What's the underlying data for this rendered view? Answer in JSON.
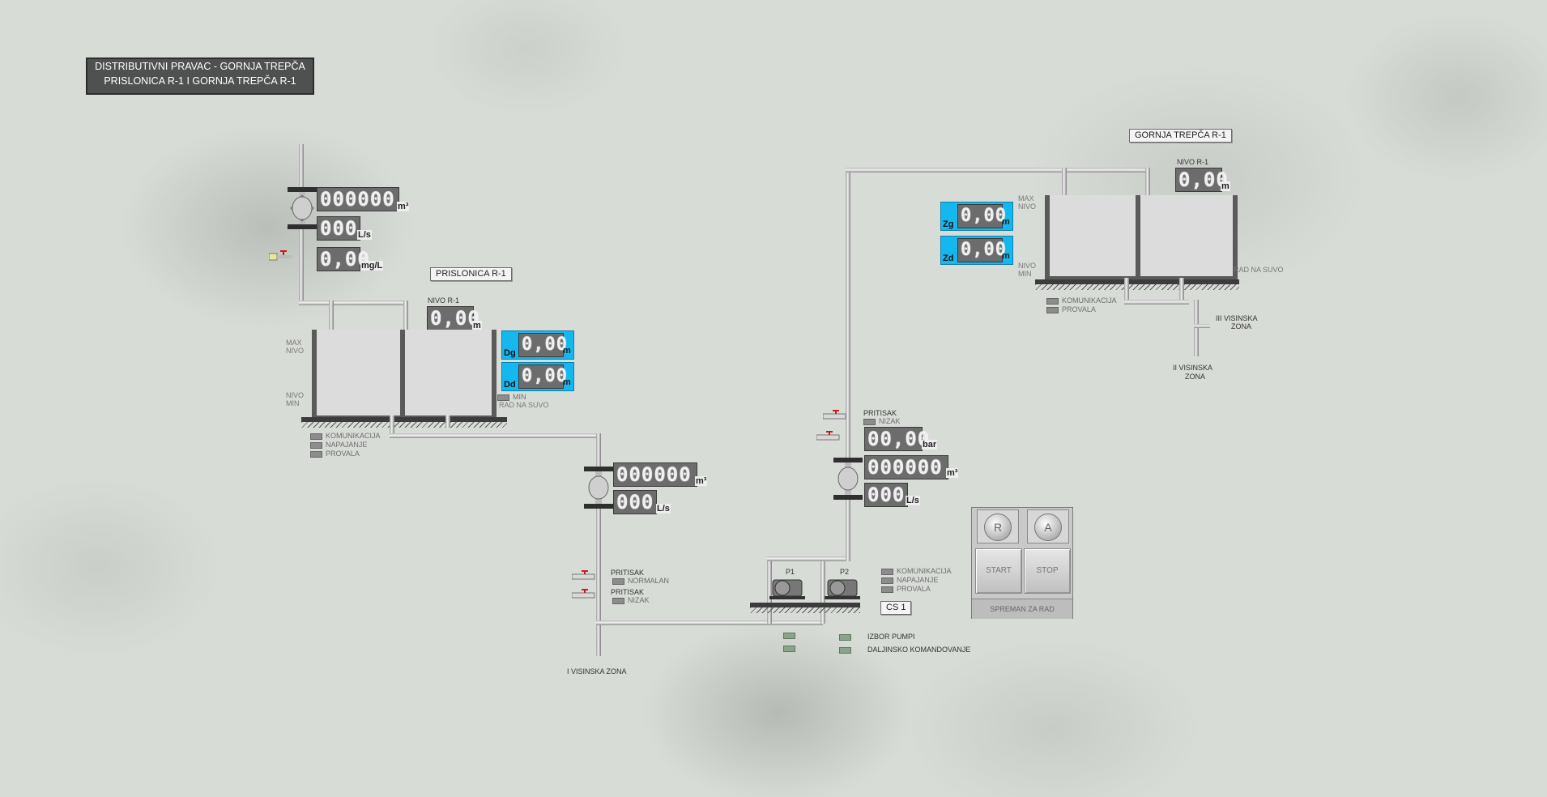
{
  "title": {
    "line1": "DISTRIBUTIVNI PRAVAC - GORNJA TREPČA",
    "line2": "PRISLONICA R-1 I GORNJA TREPČA R-1"
  },
  "prislonica": {
    "name": "PRISLONICA R-1",
    "inflow_total": "000000",
    "inflow_total_unit": "m³",
    "inflow_rate": "000",
    "inflow_rate_unit": "L/s",
    "chlorine": "0,00",
    "chlorine_unit": "mg/L",
    "level_label": "NIVO R-1",
    "level": "0,00",
    "level_unit": "m",
    "max_label": "MAX",
    "nivo_label": "NIVO",
    "min_label": "MIN",
    "dg_tag": "Dg",
    "dg_value": "0,00",
    "dg_unit": "m",
    "dd_tag": "Dd",
    "dd_value": "0,00",
    "dd_unit": "m",
    "min_flag": "MIN",
    "dry_run": "RAD NA SUVO",
    "status": [
      "KOMUNIKACIJA",
      "NAPAJANJE",
      "PROVALA"
    ]
  },
  "outflow": {
    "total": "000000",
    "total_unit": "m³",
    "rate": "000",
    "rate_unit": "L/s",
    "pressure1_label": "PRITISAK",
    "pressure1_state": "NORMALAN",
    "pressure2_label": "PRITISAK",
    "pressure2_state": "NIZAK",
    "zone": "I VISINSKA ZONA"
  },
  "cs1": {
    "name": "CS 1",
    "pump1": "P1",
    "pump2": "P2",
    "pressure_label": "PRITISAK",
    "pressure_state": "NIZAK",
    "pressure": "00,00",
    "pressure_unit": "bar",
    "total": "000000",
    "total_unit": "m³",
    "rate": "000",
    "rate_unit": "L/s",
    "status": [
      "KOMUNIKACIJA",
      "NAPAJANJE",
      "PROVALA"
    ],
    "izbor_pumpi": "IZBOR PUMPI",
    "daljinsko": "DALJINSKO KOMANDOVANJE",
    "btn_r": "R",
    "btn_a": "A",
    "btn_start": "START",
    "btn_stop": "STOP",
    "ready": "SPREMAN ZA RAD"
  },
  "gornja": {
    "name": "GORNJA TREPČA R-1",
    "level_label": "NIVO R-1",
    "level": "0,00",
    "level_unit": "m",
    "zg_tag": "Zg",
    "zg_value": "0,00",
    "zg_unit": "m",
    "zd_tag": "Zd",
    "zd_value": "0,00",
    "zd_unit": "m",
    "max_label": "MAX",
    "nivo_label": "NIVO",
    "min_label": "MIN",
    "dry_run": "RAD NA SUVO",
    "status": [
      "KOMUNIKACIJA",
      "PROVALA"
    ],
    "zone3": "III VISINSKA",
    "zone3b": "ZONA",
    "zone2": "II VISINSKA",
    "zone2b": "ZONA"
  },
  "colors": {
    "accent": "#15b7ef",
    "display": "#6c6c6c",
    "alarm_valve": "#d01818"
  }
}
